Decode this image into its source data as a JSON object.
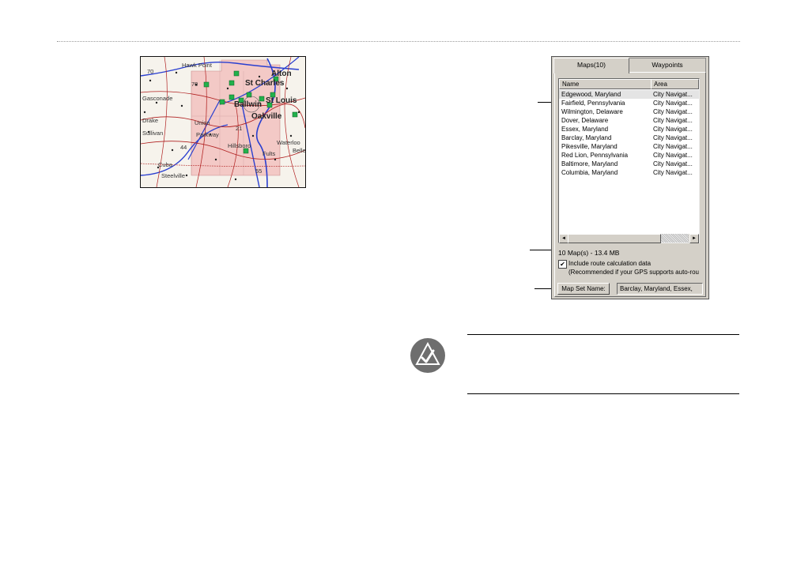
{
  "map": {
    "shields": [
      "70",
      "70",
      "44",
      "21",
      "55"
    ],
    "labels": [
      "Hawk Point",
      "St Charles",
      "Alton",
      "Gasconade",
      "Ballwin",
      "St Louis",
      "Union",
      "Oakville",
      "Drake",
      "Sullivan",
      "Parkway",
      "Hillsboro",
      "Waterloo",
      "Fults",
      "Cuba",
      "Steelville",
      "Belle"
    ]
  },
  "dialog": {
    "tabs": [
      "Maps(10)",
      "Waypoints"
    ],
    "columns": [
      "Name",
      "Area"
    ],
    "rows": [
      {
        "name": "Edgewood, Maryland",
        "area": "City Navigat..."
      },
      {
        "name": "Fairfield, Pennsylvania",
        "area": "City Navigat..."
      },
      {
        "name": "Wilmington, Delaware",
        "area": "City Navigat..."
      },
      {
        "name": "Dover, Delaware",
        "area": "City Navigat..."
      },
      {
        "name": "Essex, Maryland",
        "area": "City Navigat..."
      },
      {
        "name": "Barclay, Maryland",
        "area": "City Navigat..."
      },
      {
        "name": "Pikesville, Maryland",
        "area": "City Navigat..."
      },
      {
        "name": "Red Lion, Pennsylvania",
        "area": "City Navigat..."
      },
      {
        "name": "Baltimore, Maryland",
        "area": "City Navigat..."
      },
      {
        "name": "Columbia, Maryland",
        "area": "City Navigat..."
      }
    ],
    "scroll_left": "◄",
    "scroll_right": "►",
    "summary": "10 Map(s) - 13.4 MB",
    "checkbox_checked": "✔",
    "checkbox_label": "Include route calculation data",
    "checkbox_note": "(Recommended if your GPS supports auto-rou",
    "mapset_button": "Map Set Name:",
    "mapset_value": "Barclay, Maryland, Essex,"
  },
  "icons": {
    "note": "note-check-icon"
  },
  "colors": {
    "selection_area": "#f3c9c6",
    "interstate": "#1a24c8",
    "roads": "#b02020",
    "marker": "#22b14c"
  }
}
